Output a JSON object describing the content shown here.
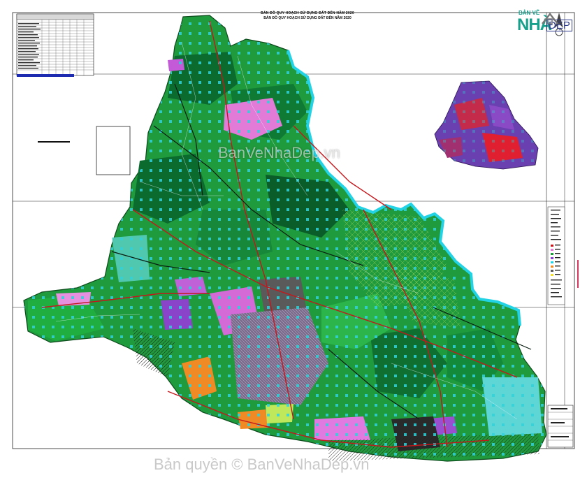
{
  "map": {
    "title_top": "BẢN ĐỒ QUY HOẠCH SỬ DỤNG ĐẤT ĐẾN NĂM 2020",
    "title_main": "BẢN ĐỒ QUY HOẠCH SỬ DỤNG ĐẤT ĐẾN NĂM 2020"
  },
  "logo": {
    "small": "BẢN VẼ",
    "big": "NHÀ",
    "dep": "ĐẸP"
  },
  "watermark_center": "BanVeNhaDep.vn",
  "copyright": "Bản quyền © BanVeNhaDep.vn",
  "colors": {
    "forest_dark": "#0b6b2e",
    "forest": "#1f9a3c",
    "green_light": "#39c24a",
    "cyan_water": "#22d3e6",
    "residential_pink": "#e27ad8",
    "urban_gray": "#5a5a5a",
    "yellow_roads": "#f2e03a",
    "orange_zone": "#f08a24",
    "purple_zone": "#8a44c9",
    "red_roads": "#c4171c"
  }
}
